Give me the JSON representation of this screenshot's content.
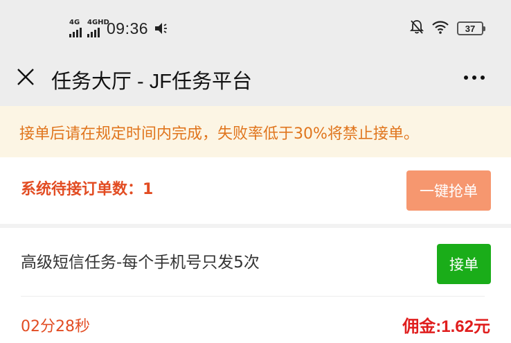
{
  "status_bar": {
    "network_1": "4G",
    "network_2": "4GHD",
    "time": "09:36",
    "battery": "37",
    "icons": [
      "signal-icon",
      "vibrate-icon",
      "mute-bell-icon",
      "wifi-icon",
      "battery-icon"
    ]
  },
  "nav": {
    "title": "任务大厅 - JF任务平台",
    "close_icon": "close-icon",
    "more_icon": "more-dots-icon"
  },
  "notice": {
    "text": "接单后请在规定时间内完成，失败率低于30%将禁止接单。"
  },
  "pending": {
    "text": "系统待接订单数：1",
    "grab_button": "一键抢单"
  },
  "task": {
    "name": "高级短信任务-每个手机号只发5次",
    "take_button": "接单",
    "countdown": "02分28秒",
    "commission": "佣金:1.62元"
  },
  "colors": {
    "header_bg": "#ededed",
    "notice_bg": "#fcf5e4",
    "notice_text": "#e0751d",
    "accent_red": "#e24c22",
    "grab_button": "#f6976f",
    "take_button": "#1aad19",
    "commission": "#e01e1e"
  }
}
